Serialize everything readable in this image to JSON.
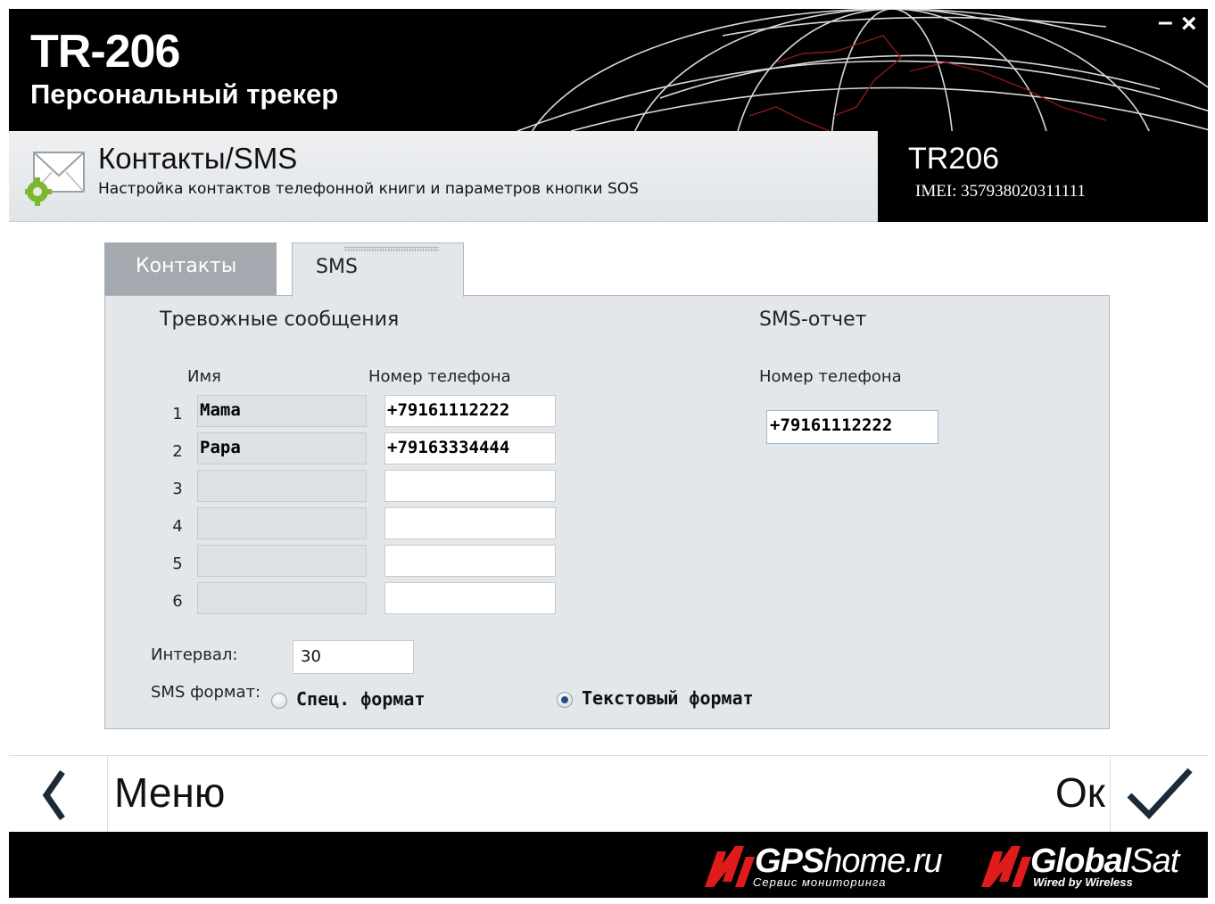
{
  "header": {
    "title": "TR-206",
    "subtitle": "Персональный трекер",
    "minimize": "–",
    "close": "×"
  },
  "section": {
    "title": "Контакты/SMS",
    "description": "Настройка контактов телефонной книги и параметров кнопки SOS",
    "icon": "envelope-gear-icon"
  },
  "device": {
    "name": "TR206",
    "imei": "IMEI: 357938020311111"
  },
  "tabs": [
    {
      "label": "Контакты",
      "active": false
    },
    {
      "label": "SMS",
      "active": true
    }
  ],
  "alarm": {
    "heading": "Тревожные сообщения",
    "col_name": "Имя",
    "col_phone": "Номер телефона",
    "rows": [
      {
        "num": "1",
        "name": "Mama",
        "phone": "+79161112222"
      },
      {
        "num": "2",
        "name": "Papa",
        "phone": "+79163334444"
      },
      {
        "num": "3",
        "name": "",
        "phone": ""
      },
      {
        "num": "4",
        "name": "",
        "phone": ""
      },
      {
        "num": "5",
        "name": "",
        "phone": ""
      },
      {
        "num": "6",
        "name": "",
        "phone": ""
      }
    ]
  },
  "report": {
    "heading": "SMS-отчет",
    "phone_label": "Номер телефона",
    "phone": "+79161112222"
  },
  "interval": {
    "label": "Интервал:",
    "value": "30"
  },
  "sms_format": {
    "label": "SMS формат:",
    "options": [
      {
        "label": "Спец. формат",
        "selected": false
      },
      {
        "label": "Текстовый формат",
        "selected": true
      }
    ]
  },
  "nav": {
    "back_label": "Меню",
    "ok_label": "Ок"
  },
  "branding": {
    "gpshome_bold": "GPS",
    "gpshome_rest": "home.ru",
    "gpshome_tagline": "Сервис мониторинга",
    "globalsat_bold": "Global",
    "globalsat_rest": "Sat",
    "globalsat_tagline": "Wired by Wireless",
    "accent_color": "#e01b1b"
  }
}
